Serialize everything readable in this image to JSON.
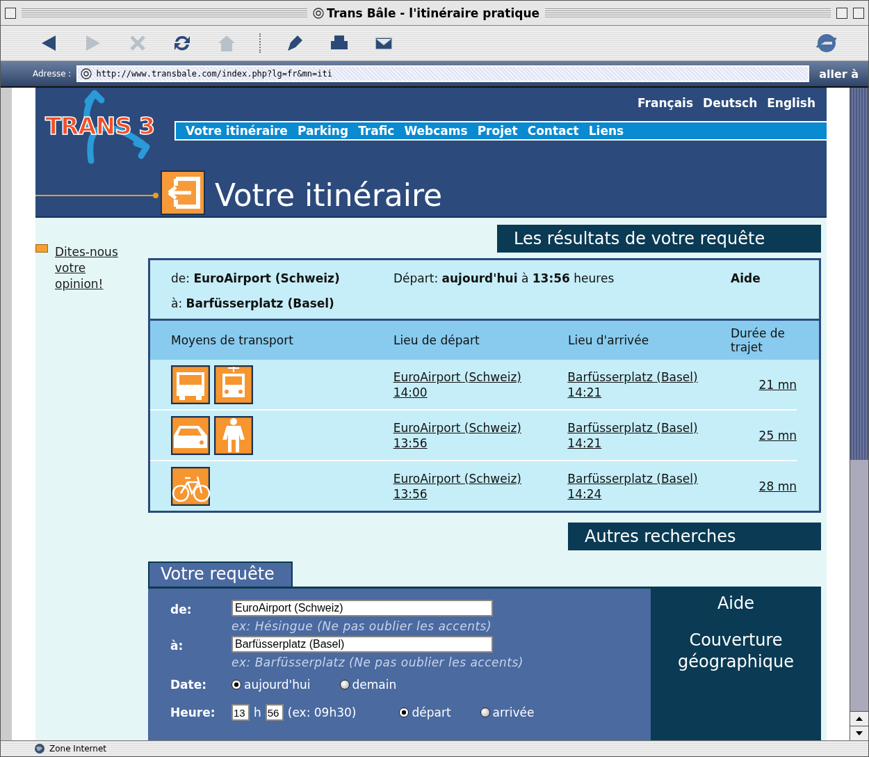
{
  "window": {
    "title": "Trans Bâle - l'itinéraire pratique"
  },
  "toolbar": [
    {
      "kind": "back",
      "disabled": false
    },
    {
      "kind": "forward",
      "disabled": true
    },
    {
      "kind": "stop",
      "disabled": true
    },
    {
      "kind": "refresh",
      "disabled": false
    },
    {
      "kind": "home",
      "disabled": true
    },
    {
      "kind": "separator"
    },
    {
      "kind": "edit",
      "disabled": false
    },
    {
      "kind": "print",
      "disabled": false
    },
    {
      "kind": "mail",
      "disabled": false
    }
  ],
  "address_bar": {
    "label": "Adresse :",
    "url": "http://www.transbale.com/index.php?lg=fr&mn=iti",
    "go": "aller à"
  },
  "site": {
    "logo": "TRANS 3",
    "languages": [
      "Français",
      "Deutsch",
      "English"
    ],
    "nav": [
      "Votre itinéraire",
      "Parking",
      "Trafic",
      "Webcams",
      "Projet",
      "Contact",
      "Liens"
    ],
    "page_title": "Votre itinéraire"
  },
  "sidebar": {
    "feedback_link": "Dites-nous votre opinion!"
  },
  "results": {
    "heading": "Les résultats de votre requête",
    "summary": {
      "from": "de: **EuroAirport (Schweiz)**",
      "departure": "Départ: **aujourd'hui** à **13:56** heures",
      "help": "Aide",
      "to": "à: **Barfüsserplatz (Basel)**"
    },
    "columns": [
      "Moyens de transport",
      "Lieu de départ",
      "Lieu d'arrivée",
      "Durée de trajet"
    ],
    "rows": [
      {
        "modes": [
          {
            "kind": "bus"
          },
          {
            "kind": "tram"
          }
        ],
        "departure_place": "EuroAirport (Schweiz)",
        "departure_time": "14:00",
        "arrival_place": "Barfüsserplatz (Basel)",
        "arrival_time": "14:21",
        "duration": "21 mn"
      },
      {
        "modes": [
          {
            "kind": "car"
          },
          {
            "kind": "walk"
          }
        ],
        "departure_place": "EuroAirport (Schweiz)",
        "departure_time": "13:56",
        "arrival_place": "Barfüsserplatz (Basel)",
        "arrival_time": "14:21",
        "duration": "25 mn"
      },
      {
        "modes": [
          {
            "kind": "bike"
          }
        ],
        "departure_place": "EuroAirport (Schweiz)",
        "departure_time": "13:56",
        "arrival_place": "Barfüsserplatz (Basel)",
        "arrival_time": "14:24",
        "duration": "28 mn"
      }
    ]
  },
  "other_searches": {
    "heading": "Autres recherches"
  },
  "request": {
    "tab": "Votre requête",
    "from": {
      "label": "de:",
      "value": "EuroAirport (Schweiz)",
      "hint": "ex: Hésingue (Ne pas oublier les accents)"
    },
    "to": {
      "label": "à:",
      "value": "Barfüsserplatz (Basel)",
      "hint": "ex: Barfüsserplatz (Ne pas oublier les accents)"
    },
    "date": {
      "label": "Date:",
      "options": [
        {
          "label": "aujourd'hui",
          "selected": true
        },
        {
          "label": "demain",
          "selected": false
        }
      ]
    },
    "time": {
      "label": "Heure:",
      "hour": "13",
      "separator": "h",
      "minute": "56",
      "hint": "(ex: 09h30)",
      "options": [
        {
          "label": "départ",
          "selected": true
        },
        {
          "label": "arrivée",
          "selected": false
        }
      ]
    },
    "side_links": [
      "Aide",
      "Couverture géographique"
    ]
  },
  "status_bar": {
    "zone": "Zone Internet"
  }
}
